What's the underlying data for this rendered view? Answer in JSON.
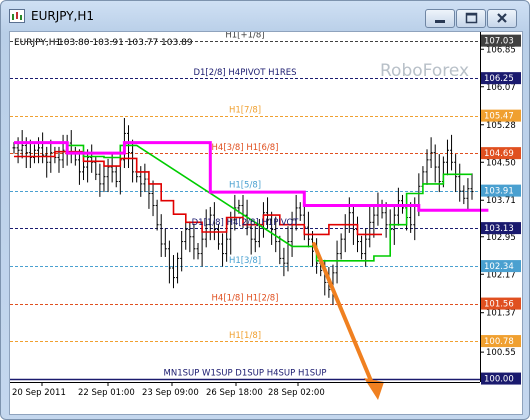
{
  "window": {
    "title": "EURJPY,H1",
    "buttons": {
      "minimize": "minimize",
      "maximize": "maximize",
      "close": "close"
    }
  },
  "chart_header": {
    "symbol_tf": "EURJPY,H1",
    "ohlc": "103.80 103.91 103.77 103.89"
  },
  "watermark": "RoboForex",
  "chart_data": {
    "type": "candlestick",
    "symbol": "EURJPY",
    "timeframe": "H1",
    "ylim": [
      99.97,
      107.21
    ],
    "price_ticks": [
      "106.85",
      "106.07",
      "105.28",
      "104.50",
      "103.71",
      "102.95",
      "102.17",
      "101.37",
      "100.55"
    ],
    "x_ticks": [
      "20 Sep 2011",
      "22 Sep 01:00",
      "23 Sep 09:00",
      "26 Sep 18:00",
      "28 Sep 02:00"
    ],
    "levels": [
      {
        "label": "H1[+1/8]",
        "price": 107.03,
        "color": "#404040",
        "style": "dashed"
      },
      {
        "label": "D1[2/8] H4PIVOT H1RES",
        "price": 106.25,
        "color": "#1a1a6e",
        "style": "dashed"
      },
      {
        "label": "H1[7/8]",
        "price": 105.47,
        "color": "#f0a030",
        "style": "dashed"
      },
      {
        "label": "H4[3/8] H1[6/8]",
        "price": 104.69,
        "color": "#e05020",
        "style": "dashed"
      },
      {
        "label": "H1[5/8]",
        "price": 103.91,
        "color": "#4aa0d0",
        "style": "dashed"
      },
      {
        "label": "D1[1/8] H4[2/8] H1PIVOT",
        "price": 103.13,
        "color": "#1a1a6e",
        "style": "dashed"
      },
      {
        "label": "H1[3/8]",
        "price": 102.34,
        "color": "#4aa0d0",
        "style": "dashed"
      },
      {
        "label": "H4[1/8] H1[2/8]",
        "price": 101.56,
        "color": "#e05020",
        "style": "dashed"
      },
      {
        "label": "H1[1/8]",
        "price": 100.78,
        "color": "#f0a030",
        "style": "dashed"
      },
      {
        "label": "MN1SUP W1SUP D1SUP H4SUP H1SUP",
        "price": 100.0,
        "color": "#1a1a6e",
        "style": "solid"
      }
    ],
    "level_price_labels": [
      "107.03",
      "106.25",
      "105.47",
      "104.69",
      "103.91",
      "103.13",
      "102.34",
      "101.56",
      "100.78",
      "100.00"
    ],
    "current_price": 103.91,
    "closes": [
      104.8,
      104.75,
      104.85,
      104.7,
      104.6,
      104.75,
      104.8,
      104.65,
      104.5,
      104.7,
      104.6,
      104.55,
      104.75,
      104.9,
      104.7,
      104.55,
      104.3,
      104.4,
      104.6,
      104.5,
      104.25,
      104.05,
      104.2,
      104.4,
      104.3,
      104.1,
      104.55,
      105.1,
      104.7,
      104.3,
      104.2,
      104.05,
      104.15,
      103.85,
      103.6,
      103.2,
      102.8,
      102.7,
      102.3,
      102.1,
      102.5,
      102.85,
      103.1,
      102.95,
      102.7,
      102.6,
      102.9,
      103.2,
      103.4,
      103.1,
      102.8,
      102.6,
      102.9,
      103.3,
      103.55,
      103.6,
      103.4,
      103.15,
      102.9,
      102.85,
      103.2,
      103.45,
      103.3,
      103.1,
      102.85,
      102.5,
      102.4,
      102.85,
      103.3,
      103.55,
      103.4,
      103.15,
      102.9,
      102.65,
      102.4,
      102.25,
      102.0,
      101.85,
      102.2,
      102.6,
      102.9,
      103.2,
      103.45,
      103.1,
      102.85,
      102.6,
      102.9,
      103.25,
      103.4,
      103.6,
      103.45,
      103.2,
      103.1,
      103.4,
      103.7,
      103.55,
      103.35,
      103.2,
      103.6,
      104.0,
      104.3,
      104.55,
      104.7,
      104.4,
      104.1,
      104.5,
      104.75,
      104.5,
      104.2,
      103.9,
      103.75,
      103.95,
      103.89
    ],
    "magenta_line": [
      [
        0,
        104.91
      ],
      [
        13,
        104.91
      ],
      [
        13,
        104.69
      ],
      [
        27,
        104.69
      ],
      [
        27,
        104.91
      ],
      [
        48,
        104.91
      ],
      [
        48,
        103.88
      ],
      [
        71,
        103.88
      ],
      [
        71,
        103.6
      ],
      [
        99,
        103.6
      ],
      [
        99,
        103.5
      ],
      [
        116,
        103.5
      ]
    ],
    "red_line": [
      [
        0,
        104.62
      ],
      [
        10,
        104.62
      ],
      [
        10,
        104.72
      ],
      [
        17,
        104.72
      ],
      [
        17,
        104.52
      ],
      [
        22,
        104.52
      ],
      [
        22,
        104.42
      ],
      [
        26,
        104.42
      ],
      [
        26,
        104.58
      ],
      [
        30,
        104.58
      ],
      [
        30,
        104.3
      ],
      [
        33,
        104.3
      ],
      [
        33,
        104.05
      ],
      [
        36,
        104.05
      ],
      [
        36,
        103.7
      ],
      [
        39,
        103.7
      ],
      [
        39,
        103.42
      ],
      [
        42,
        103.42
      ],
      [
        42,
        103.25
      ],
      [
        46,
        103.25
      ],
      [
        46,
        103.05
      ],
      [
        52,
        103.05
      ],
      [
        52,
        103.35
      ],
      [
        56,
        103.35
      ],
      [
        56,
        103.2
      ],
      [
        61,
        103.2
      ],
      [
        61,
        103.4
      ],
      [
        65,
        103.4
      ],
      [
        65,
        103.2
      ],
      [
        71,
        103.2
      ],
      [
        71,
        103.0
      ],
      [
        77,
        103.0
      ],
      [
        77,
        103.2
      ],
      [
        84,
        103.2
      ],
      [
        84,
        103.0
      ],
      [
        90,
        103.0
      ]
    ],
    "green_line": [
      [
        13,
        104.85
      ],
      [
        17,
        104.85
      ],
      [
        17,
        104.62
      ],
      [
        22,
        104.62
      ],
      [
        22,
        104.6
      ],
      [
        26,
        104.6
      ],
      [
        26,
        104.85
      ],
      [
        30,
        104.85
      ],
      [
        68,
        102.75
      ],
      [
        74,
        102.75
      ],
      [
        74,
        102.45
      ],
      [
        84,
        102.45
      ],
      [
        84,
        102.45
      ],
      [
        88,
        102.45
      ],
      [
        88,
        102.55
      ],
      [
        92,
        102.55
      ],
      [
        92,
        103.2
      ],
      [
        96,
        103.2
      ],
      [
        96,
        103.85
      ],
      [
        100,
        103.85
      ],
      [
        100,
        104.05
      ],
      [
        105,
        104.05
      ],
      [
        105,
        104.25
      ],
      [
        112,
        104.25
      ]
    ],
    "arrow": {
      "from": [
        304,
        212
      ],
      "to": [
        368,
        368
      ],
      "color": "#f08020"
    }
  }
}
